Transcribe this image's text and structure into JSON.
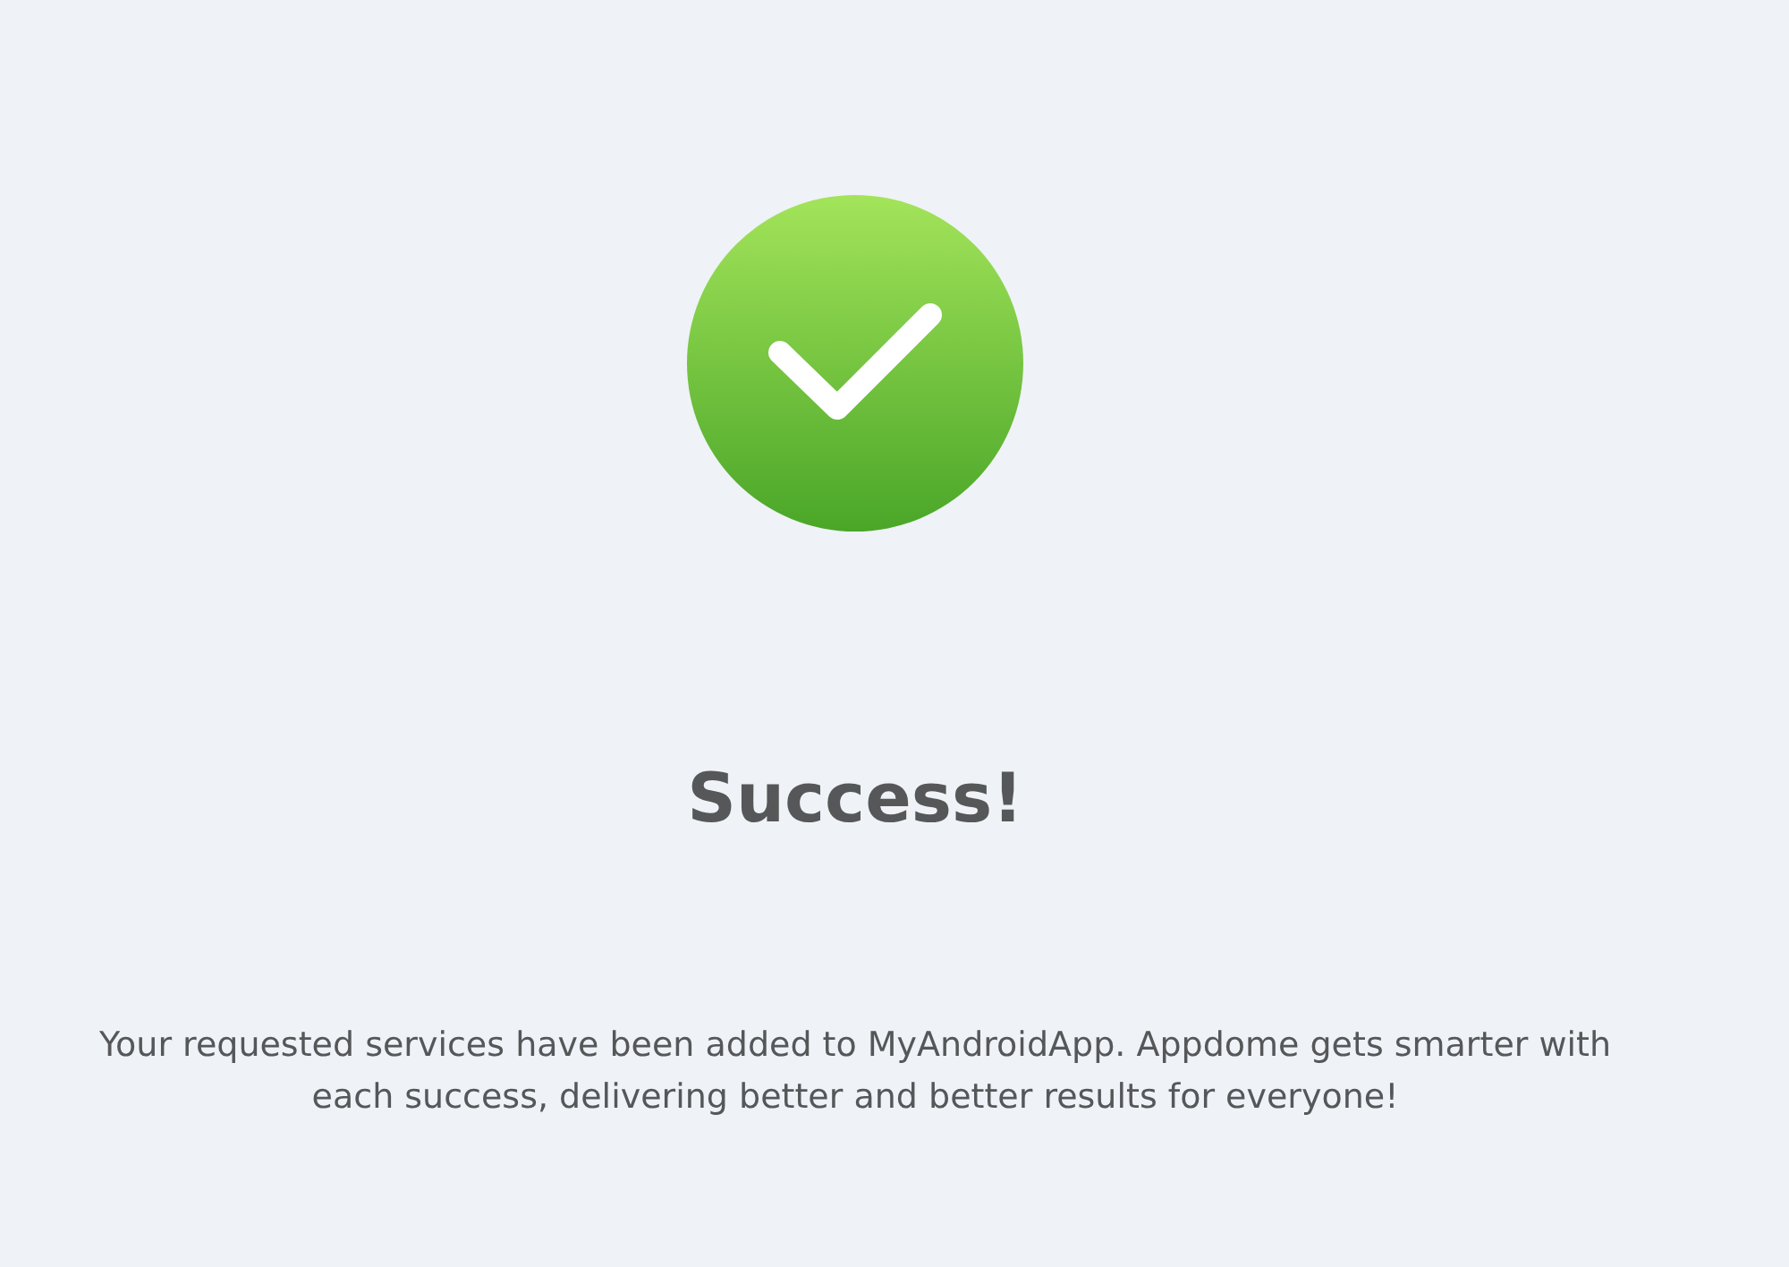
{
  "status": {
    "kind": "success"
  },
  "title": "Success!",
  "message": "Your requested services have been added to MyAndroidApp. Appdome gets smarter with each success, delivering better and better results for everyone!"
}
